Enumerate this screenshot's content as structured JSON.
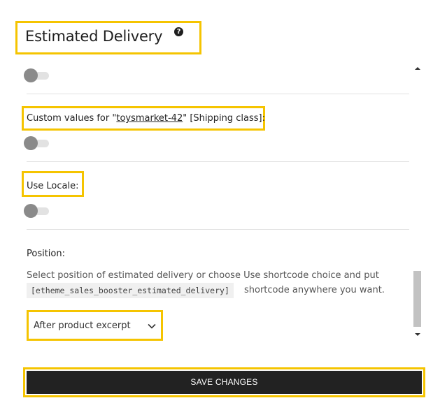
{
  "header": {
    "title": "Estimated Delivery",
    "help_icon": "question-circle-icon"
  },
  "settings": {
    "custom_values": {
      "prefix": "Custom values for \"",
      "link_text": "toysmarket-42",
      "suffix": "\" [Shipping class]:",
      "enabled": false
    },
    "use_locale": {
      "label": "Use Locale:",
      "enabled": false
    },
    "top_toggle": {
      "enabled": false
    },
    "position": {
      "label": "Position:",
      "description": "Select position of estimated delivery or choose Use shortcode choice and put",
      "shortcode": "[etheme_sales_booster_estimated_delivery]",
      "description_suffix": "shortcode anywhere you want.",
      "selected": "After product excerpt"
    }
  },
  "actions": {
    "save_label": "SAVE CHANGES"
  },
  "colors": {
    "highlight": "#f5c400",
    "button_bg": "#222222"
  }
}
